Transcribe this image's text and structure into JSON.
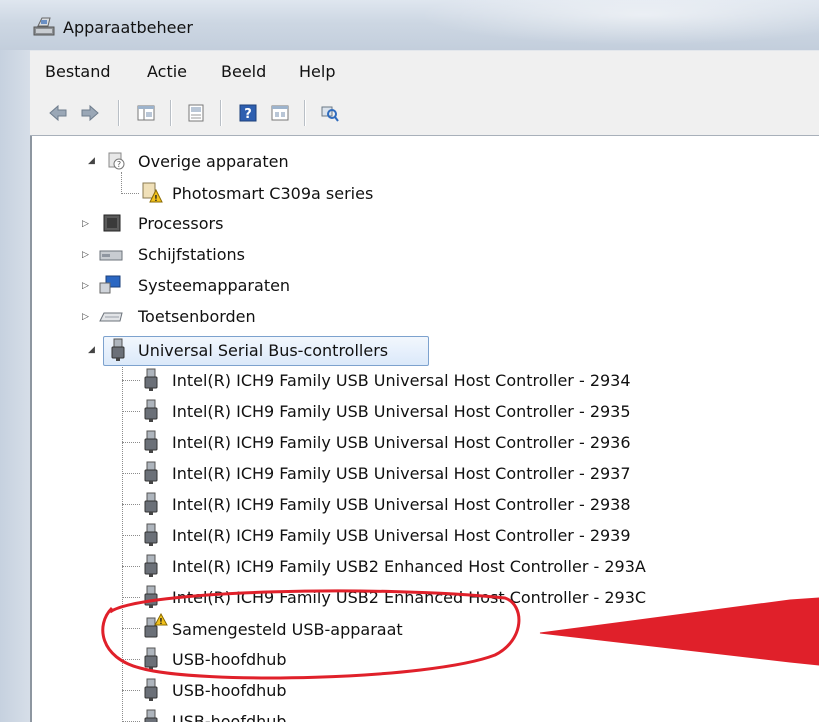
{
  "window": {
    "title": "Apparaatbeheer"
  },
  "menu": {
    "items": [
      "Bestand",
      "Actie",
      "Beeld",
      "Help"
    ]
  },
  "toolbar": {
    "buttons": [
      "back-arrow-icon",
      "forward-arrow-icon",
      "show-hide-tree-icon",
      "properties-icon",
      "help-icon",
      "view-icon",
      "scan-hardware-icon"
    ]
  },
  "tree": {
    "other_devices": "Overige apparaten",
    "photosmart": "Photosmart C309a series",
    "processors": "Processors",
    "disk_drives": "Schijfstations",
    "system_devices": "Systeemapparaten",
    "keyboards": "Toetsenborden",
    "usb_controllers": "Universal Serial Bus-controllers",
    "usb_children": [
      "Intel(R) ICH9 Family USB Universal Host Controller - 2934",
      "Intel(R) ICH9 Family USB Universal Host Controller - 2935",
      "Intel(R) ICH9 Family USB Universal Host Controller - 2936",
      "Intel(R) ICH9 Family USB Universal Host Controller - 2937",
      "Intel(R) ICH9 Family USB Universal Host Controller - 2938",
      "Intel(R) ICH9 Family USB Universal Host Controller - 2939",
      "Intel(R) ICH9 Family USB2 Enhanced Host Controller - 293A",
      "Intel(R) ICH9 Family USB2 Enhanced Host Controller - 293C",
      "Samengesteld USB-apparaat",
      "USB-hoofdhub",
      "USB-hoofdhub",
      "USB-hoofdhub"
    ]
  },
  "annotation": {
    "color": "#e0202a"
  }
}
